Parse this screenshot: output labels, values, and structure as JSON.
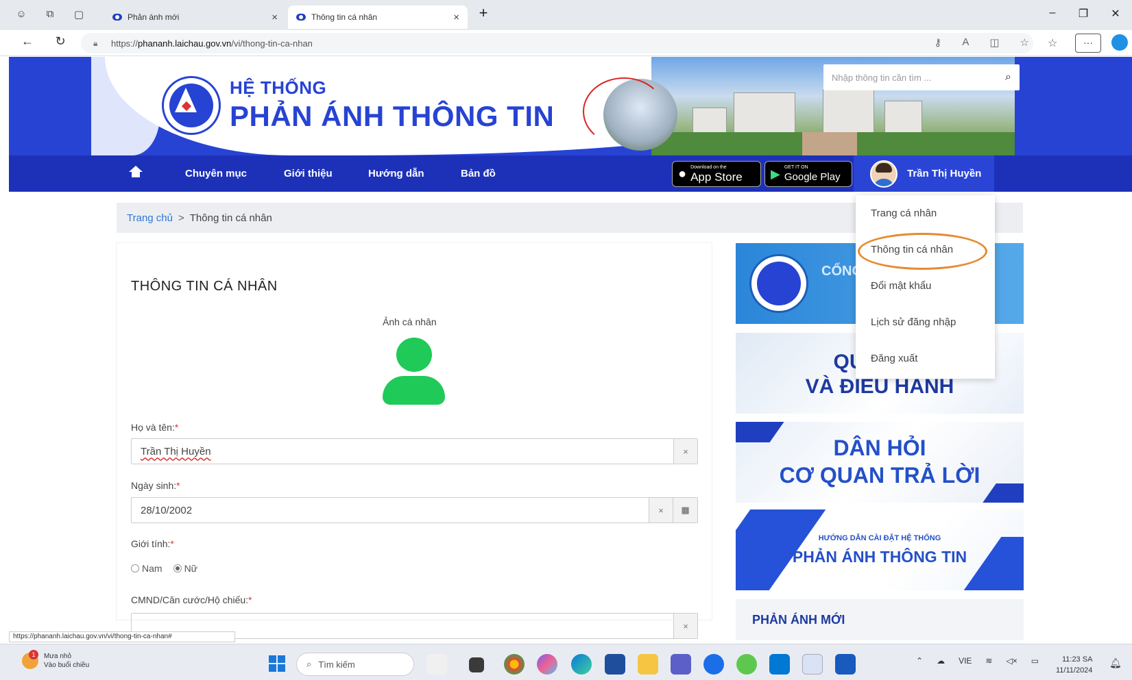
{
  "browser": {
    "tabs": [
      {
        "title": "Phản ánh mới"
      },
      {
        "title": "Thông tin cá nhân"
      }
    ],
    "url_prefix": "https://",
    "url_host": "phananh.laichau.gov.vn",
    "url_path": "/vi/thong-tin-ca-nhan"
  },
  "site": {
    "title_small": "HỆ THỐNG",
    "title_big": "PHẢN ÁNH THÔNG TIN",
    "search_placeholder": "Nhập thông tin cần tìm ...",
    "nav": [
      "Chuyên mục",
      "Giới thiệu",
      "Hướng dẫn",
      "Bản đồ"
    ],
    "app_store": {
      "small": "Download on the",
      "big": "App Store"
    },
    "google_play": {
      "small": "GET IT ON",
      "big": "Google Play"
    },
    "user_name": "Trần Thị Huyền"
  },
  "user_menu": [
    "Trang cá nhân",
    "Thông tin cá nhân",
    "Đổi mật khẩu",
    "Lịch sử đăng nhập",
    "Đăng xuất"
  ],
  "breadcrumb": {
    "home": "Trang chủ",
    "sep": ">",
    "current": "Thông tin cá nhân"
  },
  "form": {
    "title": "THÔNG TIN CÁ NHÂN",
    "avatar_label": "Ảnh cá nhân",
    "name_label": "Họ và tên:",
    "name_value": "Trần Thị Huyền",
    "dob_label": "Ngày sinh:",
    "dob_value": "28/10/2002",
    "gender_label": "Giới tính:",
    "gender_options": [
      "Nam",
      "Nữ"
    ],
    "gender_selected": "Nữ",
    "id_label": "CMND/Căn cước/Hộ chiếu:",
    "id_value": "",
    "required_mark": "*",
    "clear_symbol": "×"
  },
  "sidebar": {
    "banner1_text": "CỔNG",
    "banner2_line1": "QUẢN LÝ",
    "banner2_line2": "VÀ ĐIỀU HÀNH",
    "banner3_line1": "DÂN HỎI",
    "banner3_line2": "CƠ QUAN TRẢ LỜI",
    "banner4_sub": "HƯỚNG DẪN CÀI ĐẶT HỆ THỐNG",
    "banner4_title": "PHẢN ÁNH THÔNG TIN",
    "section_title": "PHẢN ÁNH MỚI"
  },
  "status_url": "https://phananh.laichau.gov.vn/vi/thong-tin-ca-nhan#",
  "taskbar": {
    "weather_title": "Mưa nhỏ",
    "weather_sub": "Vào buổi chiều",
    "weather_badge": "1",
    "search": "Tìm kiếm",
    "lang": "VIE",
    "time": "11:23 SA",
    "date": "11/11/2024"
  }
}
